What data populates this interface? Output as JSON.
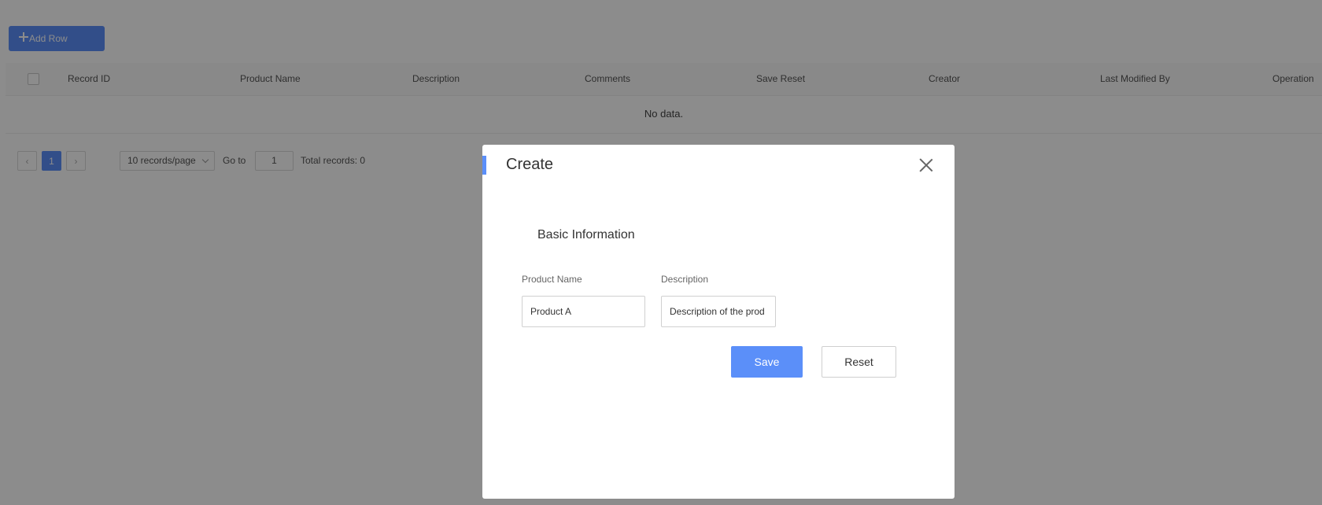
{
  "toolbar": {
    "add_row_label": "Add Row"
  },
  "table": {
    "columns": [
      "Record ID",
      "Product Name",
      "Description",
      "Comments",
      "Save Reset",
      "Creator",
      "Last Modified By",
      "Operation"
    ],
    "empty_text": "No data."
  },
  "pagination": {
    "current_page": "1",
    "page_size": "10 records/page",
    "goto_label": "Go to",
    "goto_value": "1",
    "total_text": "Total records: 0"
  },
  "modal": {
    "title": "Create",
    "section_title": "Basic Information",
    "fields": [
      {
        "label": "Product Name",
        "value": "Product A"
      },
      {
        "label": "Description",
        "value": "Description of the prod"
      }
    ],
    "save_label": "Save",
    "reset_label": "Reset"
  },
  "colors": {
    "accent": "#5b8ff9",
    "mask": "rgba(0,0,0,0.45)"
  }
}
